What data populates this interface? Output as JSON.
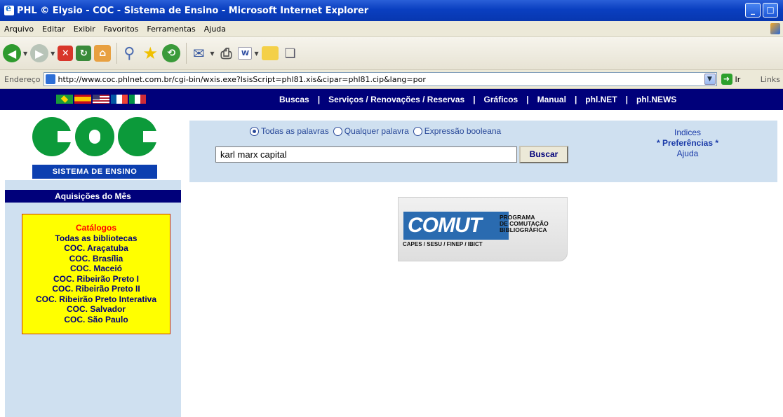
{
  "window": {
    "title": "PHL © Elysio - COC - Sistema de Ensino - Microsoft Internet Explorer",
    "controls": [
      "_",
      "□"
    ]
  },
  "menu": [
    "Arquivo",
    "Editar",
    "Exibir",
    "Favoritos",
    "Ferramentas",
    "Ajuda"
  ],
  "toolbar": {
    "icons": [
      "back-icon",
      "forward-icon",
      "stop-icon",
      "refresh-icon",
      "home-icon",
      "search-icon",
      "favorites-icon",
      "history-icon",
      "mail-icon",
      "print-icon",
      "edit-icon",
      "folder-icon",
      "research-icon"
    ]
  },
  "address": {
    "label": "Endereço",
    "url": "http://www.coc.phlnet.com.br/cgi-bin/wxis.exe?IsisScript=phl81.xis&cipar=phl81.cip&lang=por",
    "go_label": "Ir",
    "links_label": "Links"
  },
  "nav": {
    "links": [
      "Buscas",
      "Serviços / Renovações / Reservas",
      "Gráficos",
      "Manual",
      "phl.NET",
      "phl.NEWS"
    ]
  },
  "logo": {
    "tagline": "SISTEMA DE ENSINO"
  },
  "search": {
    "options": [
      "Todas as palavras",
      "Qualquer palavra",
      "Expressão booleana"
    ],
    "selected": "Todas as palavras",
    "query": "karl marx capital",
    "button": "Buscar"
  },
  "sidelinks": {
    "indices": "Indices",
    "preferencias": "* Preferências *",
    "ajuda": "Ajuda"
  },
  "acquisitions": {
    "heading": "Aquisições do Mês",
    "catalog_title": "Catálogos",
    "items": [
      "Todas as bibliotecas",
      "COC. Araçatuba",
      "COC. Brasília",
      "COC. Maceió",
      "COC. Ribeirão Preto I",
      "COC. Ribeirão Preto II",
      "COC. Ribeirão Preto Interativa",
      "COC. Salvador",
      "COC. São Paulo"
    ]
  },
  "comut": {
    "word": "COMUT",
    "program_lines": [
      "PROGRAMA",
      "DE COMUTAÇÃO",
      "BIBLIOGRÁFICA"
    ],
    "sub": "CAPES / SESU / FINEP / IBICT"
  }
}
